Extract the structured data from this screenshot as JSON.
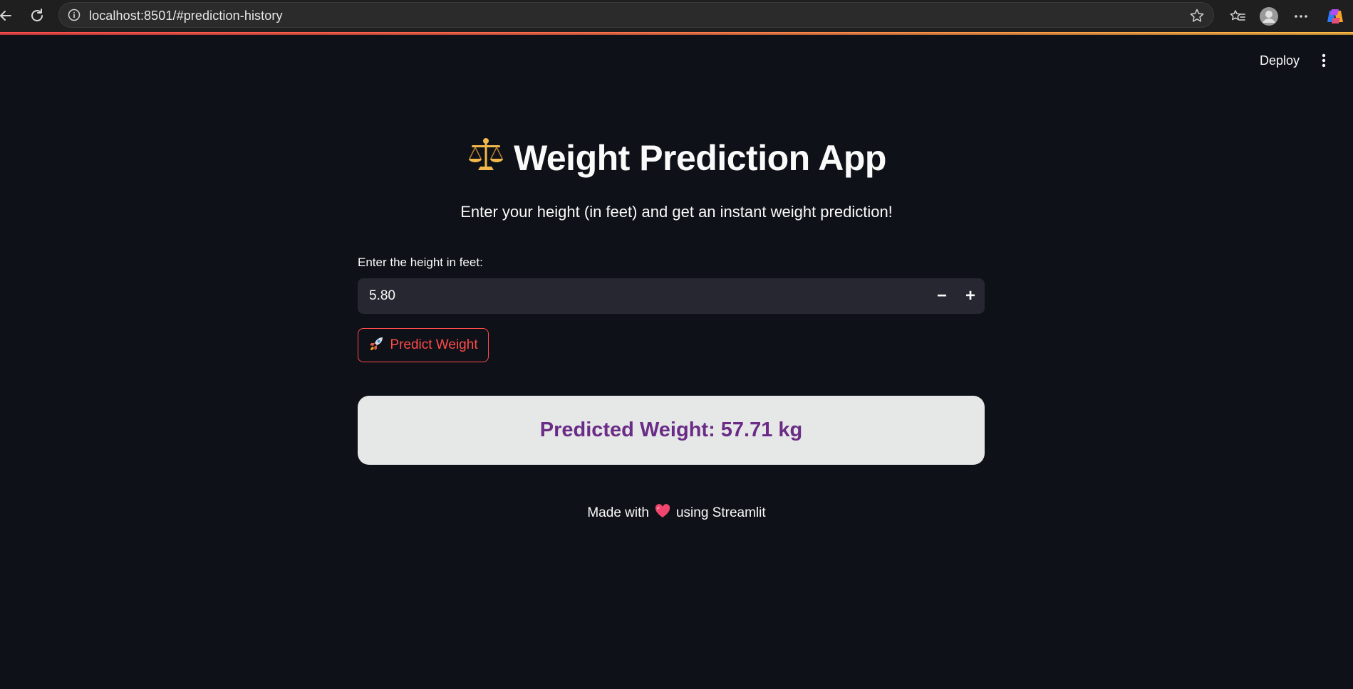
{
  "browser": {
    "url": "localhost:8501/#prediction-history",
    "icons": {
      "back": "back-arrow-icon",
      "reload": "reload-icon",
      "info": "info-icon",
      "favorite": "star-icon",
      "favorites_list": "favorites-icon",
      "profile": "profile-icon",
      "more": "more-icon",
      "copilot": "copilot-icon"
    }
  },
  "header": {
    "deploy_label": "Deploy"
  },
  "main": {
    "title": "Weight Prediction App",
    "title_icon": "balance-scale-icon",
    "subtitle": "Enter your height (in feet) and get an instant weight prediction!",
    "input_label": "Enter the height in feet:",
    "input_value": "5.80",
    "decrement_label": "−",
    "increment_label": "+",
    "predict_button_label": "Predict Weight",
    "predict_button_icon": "rocket-icon",
    "result_text": "Predicted Weight: 57.71 kg"
  },
  "footer": {
    "prefix": "Made with",
    "heart_icon": "heart-icon",
    "suffix": "using Streamlit"
  },
  "colors": {
    "background": "#0e1117",
    "input_background": "#262730",
    "accent": "#ff4b4b",
    "result_background": "#e6e8e8",
    "result_text": "#6a2c86"
  }
}
